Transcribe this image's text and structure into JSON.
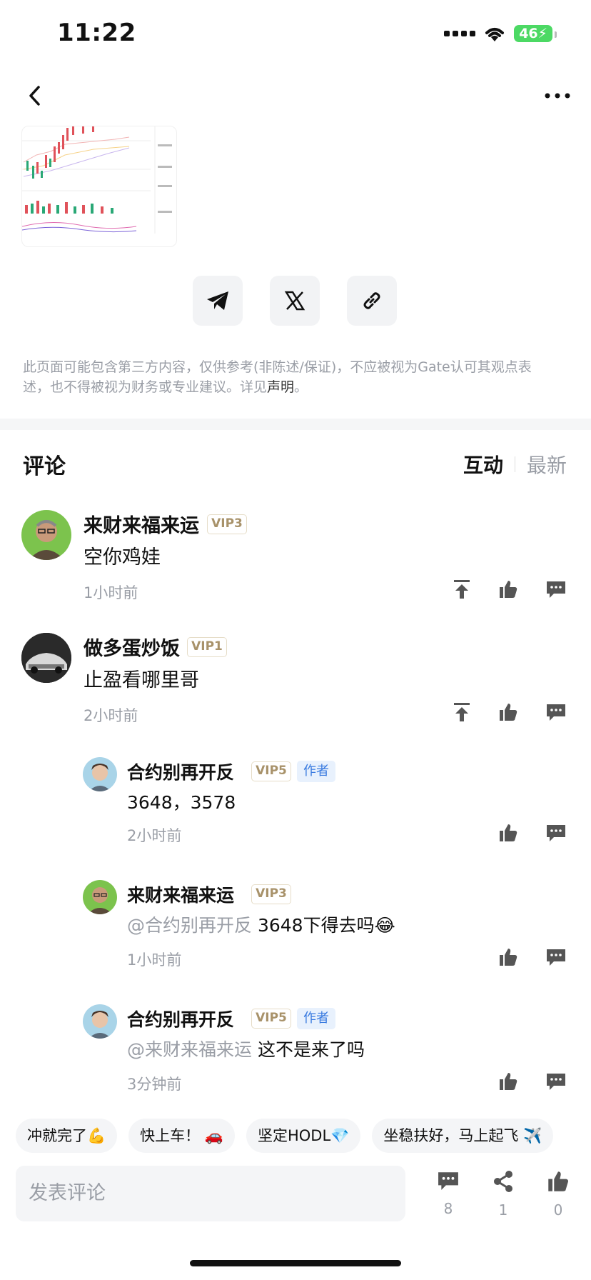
{
  "status_bar": {
    "time": "11:22",
    "battery": "46"
  },
  "disclaimer": {
    "text": "此页面可能包含第三方内容，仅供参考(非陈述/保证)，不应被视为Gate认可其观点表述，也不得被视为财务或专业建议。详见",
    "link": "声明",
    "end": "。"
  },
  "comments_section": {
    "title": "评论",
    "tab_active": "互动",
    "tab_inactive": "最新"
  },
  "comments": [
    {
      "name": "来财来福来运",
      "vip": "VIP3",
      "text": "空你鸡娃",
      "time": "1小时前"
    },
    {
      "name": "做多蛋炒饭",
      "vip": "VIP1",
      "text": "止盈看哪里哥",
      "time": "2小时前"
    }
  ],
  "replies": [
    {
      "name": "合约别再开反",
      "vip": "VIP5",
      "author": "作者",
      "mention": "",
      "text": "3648，3578",
      "time": "2小时前"
    },
    {
      "name": "来财来福来运",
      "vip": "VIP3",
      "author": "",
      "mention": "@合约别再开反",
      "text": " 3648下得去吗😂",
      "time": "1小时前"
    },
    {
      "name": "合约别再开反",
      "vip": "VIP5",
      "author": "作者",
      "mention": "@来财来福来运",
      "text": " 这不是来了吗",
      "time": "3分钟前"
    }
  ],
  "quick_replies": [
    "冲就完了💪",
    "快上车！ 🚗",
    "坚定HODL💎",
    "坐稳扶好，马上起飞 ✈️"
  ],
  "bottom": {
    "placeholder": "发表评论",
    "comments_count": "8",
    "shares_count": "1",
    "likes_count": "0"
  },
  "colors": {
    "vip_text": "#a8926a",
    "author_badge": "#3a7be0",
    "muted": "#9a9ea6",
    "battery": "#4cd964"
  },
  "icons": [
    "back-arrow-icon",
    "more-dots-icon",
    "telegram-icon",
    "x-logo-icon",
    "link-icon",
    "pin-top-icon",
    "like-icon",
    "comment-icon",
    "share-icon"
  ]
}
